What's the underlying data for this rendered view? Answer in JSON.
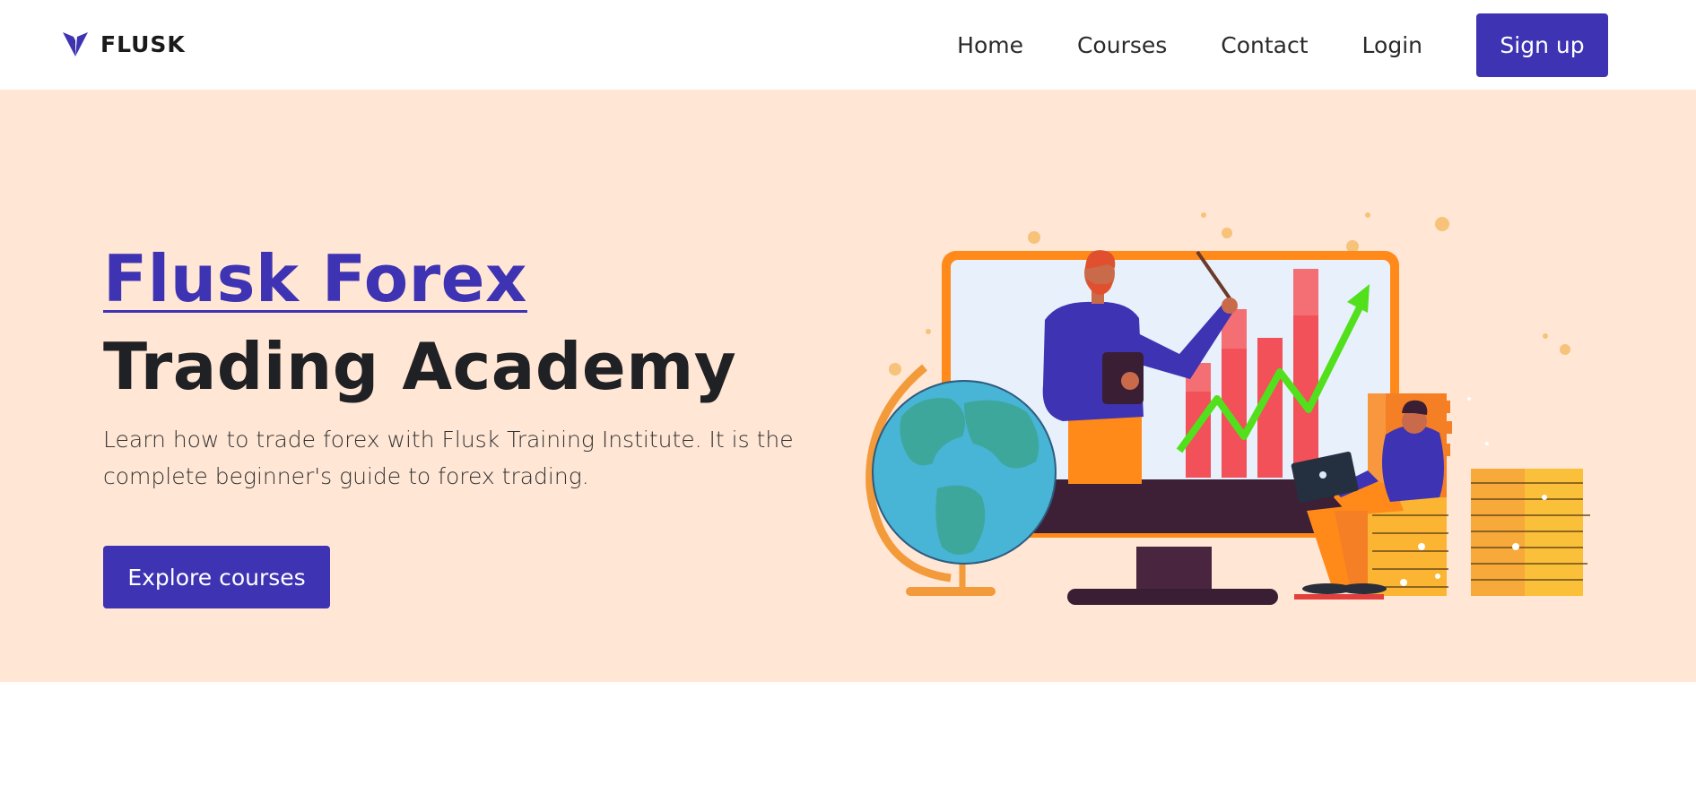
{
  "brand": {
    "name": "FLUSK",
    "logo_icon": "flusk-logo-icon",
    "accent_color": "#3e33b3"
  },
  "nav": {
    "links": [
      {
        "label": "Home"
      },
      {
        "label": "Courses"
      },
      {
        "label": "Contact"
      },
      {
        "label": "Login"
      }
    ],
    "signup_label": "Sign up"
  },
  "hero": {
    "title_accent": "Flusk Forex",
    "title_rest": "Trading Academy",
    "description": "Learn how to trade forex with Flusk Training Institute. It is the complete beginner's guide to forex trading.",
    "cta_label": "Explore courses",
    "background_color": "#ffe6d5",
    "illustration": "forex-trading-illustration"
  }
}
